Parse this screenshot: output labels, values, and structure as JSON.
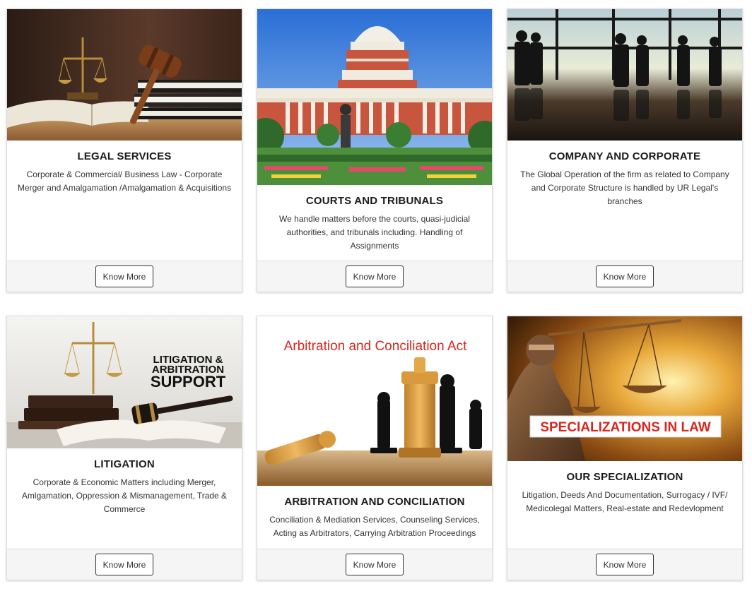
{
  "cards": [
    {
      "title": "LEGAL SERVICES",
      "description": "Corporate & Commercial/ Business Law - Corporate Merger and Amalgamation /Amalgamation & Acquisitions",
      "button": "Know More",
      "image_icon": "gavel-scales-books-image"
    },
    {
      "title": "COURTS AND TRIBUNALS",
      "description": "We handle matters before the courts, quasi-judicial authorities, and tribunals including. Handling of Assignments",
      "button": "Know More",
      "image_icon": "supreme-court-building-image"
    },
    {
      "title": "COMPANY AND CORPORATE",
      "description": "The Global Operation of the firm as related to Company and Corporate Structure is handled by UR Legal's branches",
      "button": "Know More",
      "image_icon": "business-people-silhouette-image"
    },
    {
      "title": "LITIGATION",
      "description": "Corporate & Economic Matters including Merger, Amlgamation, Oppression & Mismanagement, Trade & Commerce",
      "button": "Know More",
      "image_icon": "litigation-scales-gavel-image",
      "image_text": [
        "LITIGATION &",
        "ARBITRATION",
        "SUPPORT"
      ]
    },
    {
      "title": "ARBITRATION AND CONCILIATION",
      "description": "Conciliation & Mediation Services, Counseling Services, Acting as Arbitrators, Carrying Arbitration Proceedings",
      "button": "Know More",
      "image_icon": "chess-pieces-image",
      "image_text": "Arbitration and Conciliation Act"
    },
    {
      "title": "OUR SPECIALIZATION",
      "description": "Litigation, Deeds And Documentation, Surrogacy / IVF/ Medicolegal Matters, Real-estate and Redevlopment",
      "button": "Know More",
      "image_icon": "lady-justice-scales-image",
      "image_text": "SPECIALIZATIONS IN LAW"
    }
  ],
  "colors": {
    "button_border": "#333333",
    "footer_bg": "#f5f5f5",
    "arbitration_text": "#d9261c",
    "specialization_text": "#d9261c"
  }
}
